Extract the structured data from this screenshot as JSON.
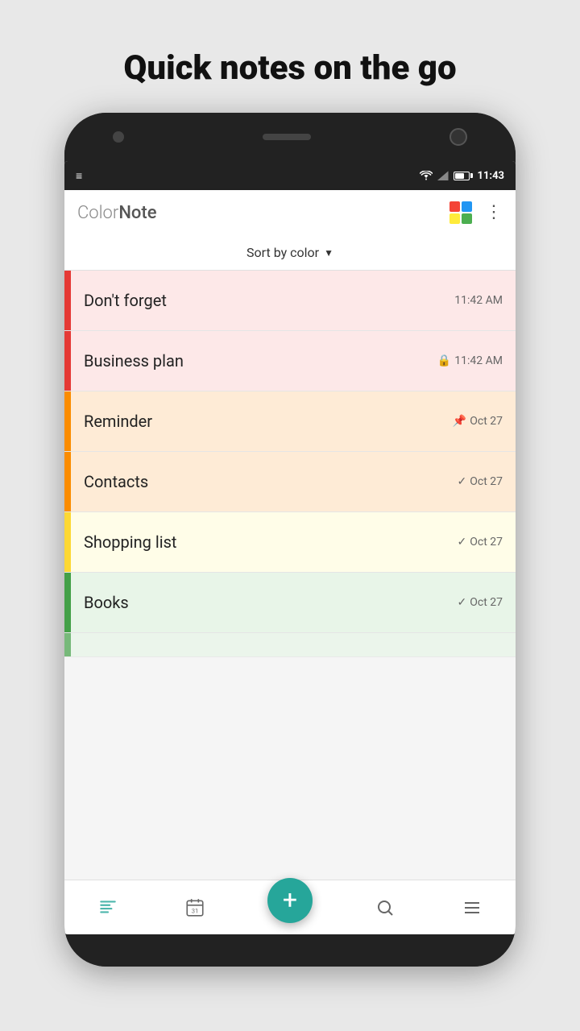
{
  "page": {
    "title": "Quick notes on the go"
  },
  "statusBar": {
    "time": "11:43"
  },
  "appBar": {
    "logo_gray": "Color",
    "logo_dark": "Note",
    "more_label": "⋮",
    "colors": [
      {
        "bg": "#f44336"
      },
      {
        "bg": "#2196f3"
      },
      {
        "bg": "#ffeb3b"
      },
      {
        "bg": "#4caf50"
      }
    ]
  },
  "sortBar": {
    "label": "Sort by color",
    "arrow": "▼"
  },
  "notes": [
    {
      "title": "Don't forget",
      "meta": "11:42 AM",
      "meta_icon": "",
      "color_bar": "#e53935",
      "bg_class": "note-red"
    },
    {
      "title": "Business plan",
      "meta": "11:42 AM",
      "meta_icon": "🔒",
      "color_bar": "#e53935",
      "bg_class": "note-red"
    },
    {
      "title": "Reminder",
      "meta": "Oct 27",
      "meta_icon": "📌",
      "color_bar": "#fb8c00",
      "bg_class": "note-orange"
    },
    {
      "title": "Contacts",
      "meta": "Oct 27",
      "meta_icon": "✓",
      "color_bar": "#fb8c00",
      "bg_class": "note-orange"
    },
    {
      "title": "Shopping list",
      "meta": "Oct 27",
      "meta_icon": "✓",
      "color_bar": "#fdd835",
      "bg_class": "note-yellow"
    },
    {
      "title": "Books",
      "meta": "Oct 27",
      "meta_icon": "✓",
      "color_bar": "#43a047",
      "bg_class": "note-green"
    }
  ],
  "fab": {
    "label": "+"
  },
  "bottomNav": [
    {
      "icon": "≡",
      "label": "notes",
      "active": true
    },
    {
      "icon": "31",
      "label": "calendar",
      "active": false
    },
    {
      "icon": "⬜",
      "label": "fab-placeholder",
      "active": false
    },
    {
      "icon": "🔍",
      "label": "search",
      "active": false
    },
    {
      "icon": "☰",
      "label": "menu",
      "active": false
    }
  ]
}
